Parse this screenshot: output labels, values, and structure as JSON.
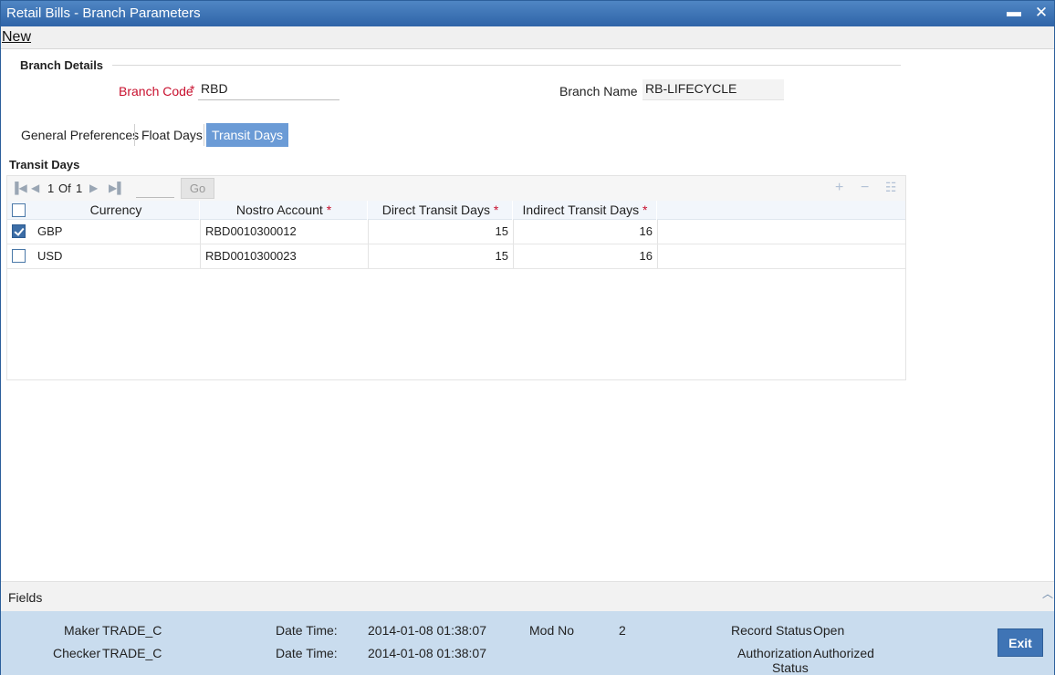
{
  "window": {
    "title": "Retail Bills - Branch Parameters",
    "minimize_glyph": "▬",
    "close_glyph": "✕"
  },
  "menu": {
    "new_label": "New"
  },
  "branch_details": {
    "section_title": "Branch Details",
    "branch_code_label": "Branch Code",
    "branch_code_value": "RBD",
    "branch_name_label": "Branch Name",
    "branch_name_value": "RB-LIFECYCLE",
    "required_marker": "*"
  },
  "tabs": [
    {
      "label": "General Preferences",
      "active": false
    },
    {
      "label": "Float Days",
      "active": false
    },
    {
      "label": "Transit Days",
      "active": true
    }
  ],
  "transit_days": {
    "section_title": "Transit Days",
    "pager": {
      "current": "1",
      "of_label": "Of",
      "total": "1",
      "go_label": "Go"
    },
    "columns": [
      {
        "label": "Currency",
        "required": false
      },
      {
        "label": "Nostro Account",
        "required": true
      },
      {
        "label": "Direct Transit Days",
        "required": true
      },
      {
        "label": "Indirect Transit Days",
        "required": true
      }
    ],
    "rows": [
      {
        "checked": true,
        "currency": "GBP",
        "nostro_account": "RBD0010300012",
        "direct_days": "15",
        "indirect_days": "16"
      },
      {
        "checked": false,
        "currency": "USD",
        "nostro_account": "RBD0010300023",
        "direct_days": "15",
        "indirect_days": "16"
      }
    ]
  },
  "fields_bar": {
    "label": "Fields"
  },
  "footer": {
    "maker_label": "Maker",
    "maker_value": "TRADE_C",
    "checker_label": "Checker",
    "checker_value": "TRADE_C",
    "date_time_label": "Date Time:",
    "maker_datetime": "2014-01-08 01:38:07",
    "checker_datetime": "2014-01-08 01:38:07",
    "mod_no_label": "Mod No",
    "mod_no_value": "2",
    "record_status_label": "Record Status",
    "record_status_value": "Open",
    "auth_status_label_1": "Authorization",
    "auth_status_label_2": "Status",
    "auth_status_value": "Authorized",
    "exit_label": "Exit"
  },
  "colors": {
    "titlebar": "#2f64a8",
    "active_tab": "#6b9bd6",
    "required": "#c8102e",
    "footer": "#c9dcee",
    "exit_button": "#3f74b5"
  }
}
